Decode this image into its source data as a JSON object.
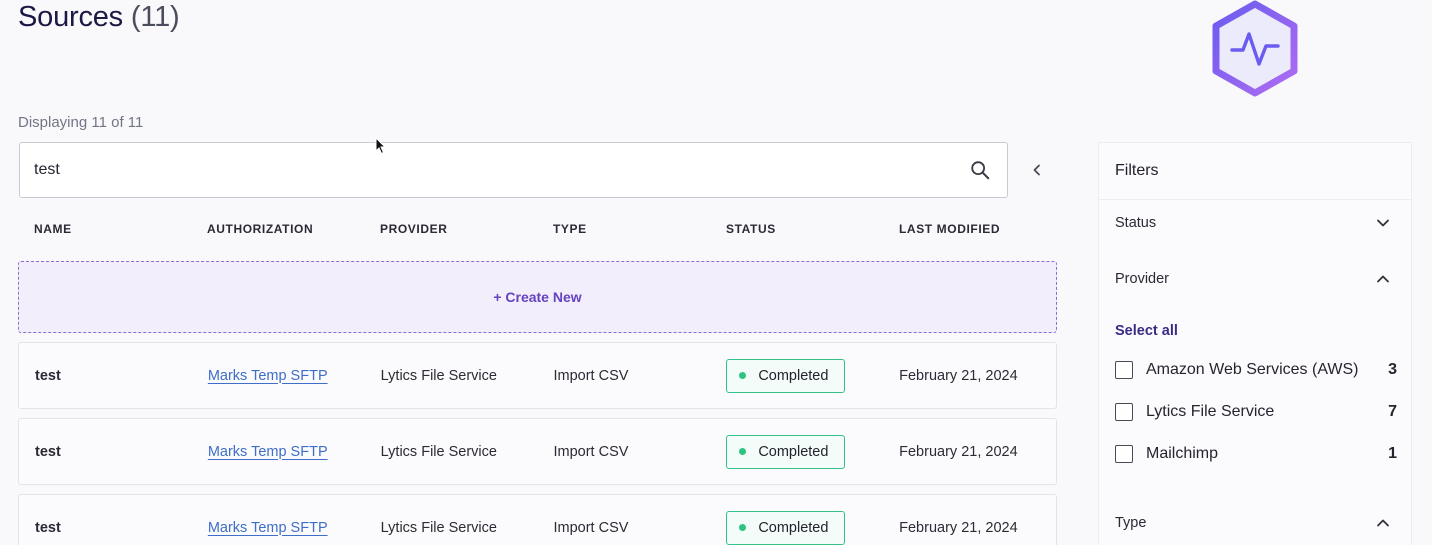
{
  "header": {
    "title": "Sources",
    "count": "(11)"
  },
  "displaying": "Displaying 11 of 11",
  "search": {
    "value": "test",
    "placeholder": ""
  },
  "table": {
    "columns": [
      "NAME",
      "AUTHORIZATION",
      "PROVIDER",
      "TYPE",
      "STATUS",
      "LAST MODIFIED"
    ],
    "create_new_label": "+ Create New",
    "rows": [
      {
        "name": "test",
        "authorization": "Marks Temp SFTP",
        "provider": "Lytics File Service",
        "type": "Import CSV",
        "status": "Completed",
        "last_modified": "February 21, 2024"
      },
      {
        "name": "test",
        "authorization": "Marks Temp SFTP",
        "provider": "Lytics File Service",
        "type": "Import CSV",
        "status": "Completed",
        "last_modified": "February 21, 2024"
      },
      {
        "name": "test",
        "authorization": "Marks Temp SFTP",
        "provider": "Lytics File Service",
        "type": "Import CSV",
        "status": "Completed",
        "last_modified": "February 21, 2024"
      }
    ]
  },
  "filters": {
    "title": "Filters",
    "status_label": "Status",
    "provider_label": "Provider",
    "select_all": "Select all",
    "provider_options": [
      {
        "label": "Amazon Web Services (AWS)",
        "count": "3"
      },
      {
        "label": "Lytics File Service",
        "count": "7"
      },
      {
        "label": "Mailchimp",
        "count": "1"
      }
    ],
    "type_label": "Type"
  },
  "colors": {
    "accent": "#6542c0",
    "status_green": "#2cc47f",
    "link": "#3e6ec7",
    "logo_gradient_start": "#6a5cf0",
    "logo_gradient_end": "#b06cf2"
  },
  "icons": {
    "search": "search-icon",
    "collapse": "chevron-left-icon",
    "logo": "pulse-hexagon-logo"
  }
}
